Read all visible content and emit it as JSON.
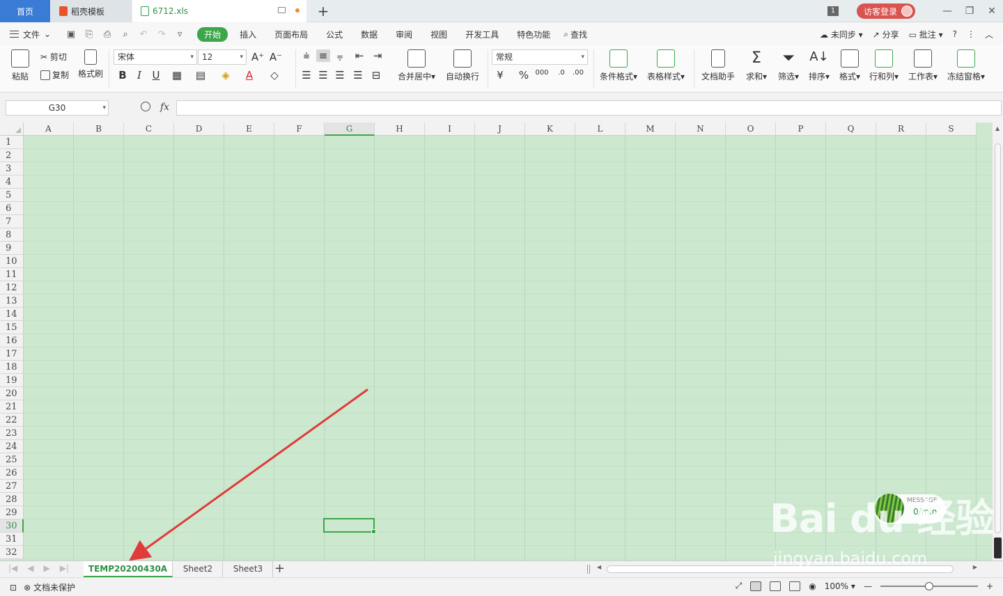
{
  "titlebar": {
    "tabs": [
      {
        "label": "首页"
      },
      {
        "label": "稻壳模板"
      },
      {
        "label": "6712.xls"
      }
    ],
    "new_tab": "+",
    "window_count": "1",
    "login_label": "访客登录",
    "min": "—",
    "restore": "❐",
    "close": "✕"
  },
  "menubar": {
    "file_label": "文件",
    "items": [
      "开始",
      "插入",
      "页面布局",
      "公式",
      "数据",
      "审阅",
      "视图",
      "开发工具",
      "特色功能"
    ],
    "search_label": "查找",
    "sync_label": "未同步",
    "share_label": "分享",
    "comment_label": "批注",
    "help": "?",
    "more": "⋮",
    "collapse": "︿"
  },
  "ribbon": {
    "paste": "粘贴",
    "cut": "剪切",
    "copy": "复制",
    "format_painter": "格式刷",
    "font_name": "宋体",
    "font_size": "12",
    "bold": "B",
    "italic": "I",
    "underline": "U",
    "merge_center": "合并居中",
    "wrap_text": "自动换行",
    "number_format": "常规",
    "percent": "%",
    "conditional_format": "条件格式",
    "table_style": "表格样式",
    "doc_assistant": "文档助手",
    "sum": "求和",
    "filter": "筛选",
    "sort": "排序",
    "format": "格式",
    "row_col": "行和列",
    "worksheet": "工作表",
    "freeze": "冻结窗格"
  },
  "formula": {
    "name_box": "G30",
    "fx": "fx",
    "value": ""
  },
  "grid": {
    "columns": [
      "A",
      "B",
      "C",
      "D",
      "E",
      "F",
      "G",
      "H",
      "I",
      "J",
      "K",
      "L",
      "M",
      "N",
      "O",
      "P",
      "Q",
      "R",
      "S"
    ],
    "rows": [
      "1",
      "2",
      "3",
      "4",
      "5",
      "6",
      "7",
      "8",
      "9",
      "10",
      "11",
      "12",
      "13",
      "14",
      "15",
      "16",
      "17",
      "18",
      "19",
      "20",
      "21",
      "22",
      "23",
      "24",
      "25",
      "26",
      "27",
      "28",
      "29",
      "30",
      "31",
      "32"
    ],
    "selected_column": "G",
    "selected_row": "30"
  },
  "sheets": {
    "tabs": [
      "TEMP20200430A",
      "Sheet2",
      "Sheet3"
    ],
    "active": "TEMP20200430A",
    "add": "+"
  },
  "statusbar": {
    "protect_label": "文档未保护",
    "zoom": "100%"
  },
  "overlay": {
    "message_title": "MESSAGE",
    "message_value": "0/min",
    "watermark": "Bai du 经验",
    "watermark_url": "jingyan.baidu.com"
  },
  "colors": {
    "accent": "#3ca64b",
    "grid_bg": "#cce8cf",
    "arrow": "#e03a3a",
    "home_tab": "#3a7bd5",
    "login": "#d9534f"
  }
}
